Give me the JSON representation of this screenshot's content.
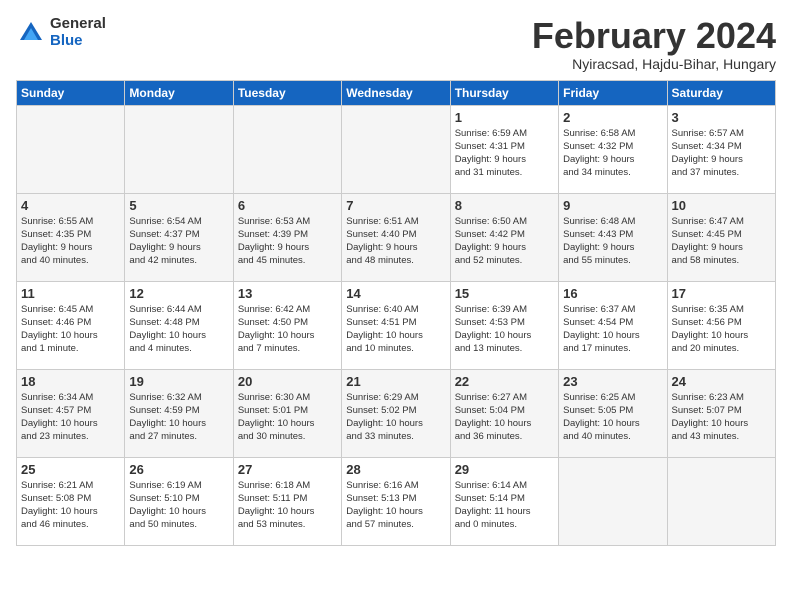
{
  "logo": {
    "general": "General",
    "blue": "Blue"
  },
  "header": {
    "month": "February 2024",
    "location": "Nyiracsad, Hajdu-Bihar, Hungary"
  },
  "weekdays": [
    "Sunday",
    "Monday",
    "Tuesday",
    "Wednesday",
    "Thursday",
    "Friday",
    "Saturday"
  ],
  "weeks": [
    [
      {
        "day": "",
        "info": ""
      },
      {
        "day": "",
        "info": ""
      },
      {
        "day": "",
        "info": ""
      },
      {
        "day": "",
        "info": ""
      },
      {
        "day": "1",
        "info": "Sunrise: 6:59 AM\nSunset: 4:31 PM\nDaylight: 9 hours\nand 31 minutes."
      },
      {
        "day": "2",
        "info": "Sunrise: 6:58 AM\nSunset: 4:32 PM\nDaylight: 9 hours\nand 34 minutes."
      },
      {
        "day": "3",
        "info": "Sunrise: 6:57 AM\nSunset: 4:34 PM\nDaylight: 9 hours\nand 37 minutes."
      }
    ],
    [
      {
        "day": "4",
        "info": "Sunrise: 6:55 AM\nSunset: 4:35 PM\nDaylight: 9 hours\nand 40 minutes."
      },
      {
        "day": "5",
        "info": "Sunrise: 6:54 AM\nSunset: 4:37 PM\nDaylight: 9 hours\nand 42 minutes."
      },
      {
        "day": "6",
        "info": "Sunrise: 6:53 AM\nSunset: 4:39 PM\nDaylight: 9 hours\nand 45 minutes."
      },
      {
        "day": "7",
        "info": "Sunrise: 6:51 AM\nSunset: 4:40 PM\nDaylight: 9 hours\nand 48 minutes."
      },
      {
        "day": "8",
        "info": "Sunrise: 6:50 AM\nSunset: 4:42 PM\nDaylight: 9 hours\nand 52 minutes."
      },
      {
        "day": "9",
        "info": "Sunrise: 6:48 AM\nSunset: 4:43 PM\nDaylight: 9 hours\nand 55 minutes."
      },
      {
        "day": "10",
        "info": "Sunrise: 6:47 AM\nSunset: 4:45 PM\nDaylight: 9 hours\nand 58 minutes."
      }
    ],
    [
      {
        "day": "11",
        "info": "Sunrise: 6:45 AM\nSunset: 4:46 PM\nDaylight: 10 hours\nand 1 minute."
      },
      {
        "day": "12",
        "info": "Sunrise: 6:44 AM\nSunset: 4:48 PM\nDaylight: 10 hours\nand 4 minutes."
      },
      {
        "day": "13",
        "info": "Sunrise: 6:42 AM\nSunset: 4:50 PM\nDaylight: 10 hours\nand 7 minutes."
      },
      {
        "day": "14",
        "info": "Sunrise: 6:40 AM\nSunset: 4:51 PM\nDaylight: 10 hours\nand 10 minutes."
      },
      {
        "day": "15",
        "info": "Sunrise: 6:39 AM\nSunset: 4:53 PM\nDaylight: 10 hours\nand 13 minutes."
      },
      {
        "day": "16",
        "info": "Sunrise: 6:37 AM\nSunset: 4:54 PM\nDaylight: 10 hours\nand 17 minutes."
      },
      {
        "day": "17",
        "info": "Sunrise: 6:35 AM\nSunset: 4:56 PM\nDaylight: 10 hours\nand 20 minutes."
      }
    ],
    [
      {
        "day": "18",
        "info": "Sunrise: 6:34 AM\nSunset: 4:57 PM\nDaylight: 10 hours\nand 23 minutes."
      },
      {
        "day": "19",
        "info": "Sunrise: 6:32 AM\nSunset: 4:59 PM\nDaylight: 10 hours\nand 27 minutes."
      },
      {
        "day": "20",
        "info": "Sunrise: 6:30 AM\nSunset: 5:01 PM\nDaylight: 10 hours\nand 30 minutes."
      },
      {
        "day": "21",
        "info": "Sunrise: 6:29 AM\nSunset: 5:02 PM\nDaylight: 10 hours\nand 33 minutes."
      },
      {
        "day": "22",
        "info": "Sunrise: 6:27 AM\nSunset: 5:04 PM\nDaylight: 10 hours\nand 36 minutes."
      },
      {
        "day": "23",
        "info": "Sunrise: 6:25 AM\nSunset: 5:05 PM\nDaylight: 10 hours\nand 40 minutes."
      },
      {
        "day": "24",
        "info": "Sunrise: 6:23 AM\nSunset: 5:07 PM\nDaylight: 10 hours\nand 43 minutes."
      }
    ],
    [
      {
        "day": "25",
        "info": "Sunrise: 6:21 AM\nSunset: 5:08 PM\nDaylight: 10 hours\nand 46 minutes."
      },
      {
        "day": "26",
        "info": "Sunrise: 6:19 AM\nSunset: 5:10 PM\nDaylight: 10 hours\nand 50 minutes."
      },
      {
        "day": "27",
        "info": "Sunrise: 6:18 AM\nSunset: 5:11 PM\nDaylight: 10 hours\nand 53 minutes."
      },
      {
        "day": "28",
        "info": "Sunrise: 6:16 AM\nSunset: 5:13 PM\nDaylight: 10 hours\nand 57 minutes."
      },
      {
        "day": "29",
        "info": "Sunrise: 6:14 AM\nSunset: 5:14 PM\nDaylight: 11 hours\nand 0 minutes."
      },
      {
        "day": "",
        "info": ""
      },
      {
        "day": "",
        "info": ""
      }
    ]
  ]
}
